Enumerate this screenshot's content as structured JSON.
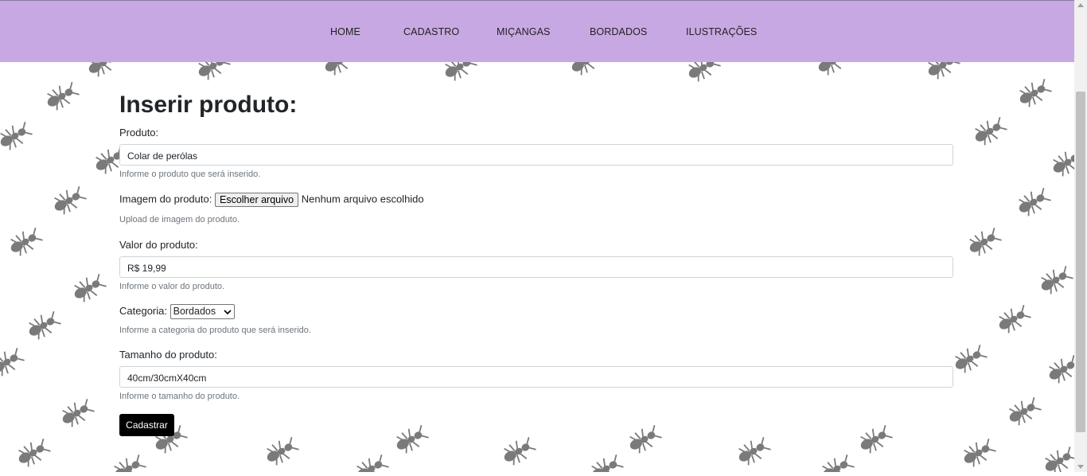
{
  "nav": {
    "items": [
      {
        "label": "HOME"
      },
      {
        "label": "CADASTRO"
      },
      {
        "label": "MIÇANGAS"
      },
      {
        "label": "BORDADOS"
      },
      {
        "label": "ILUSTRAÇÕES"
      }
    ]
  },
  "form": {
    "title": "Inserir produto:",
    "produto": {
      "label": "Produto:",
      "value": "Colar de perólas",
      "help": "Informe o produto que será inserido."
    },
    "imagem": {
      "label": "Imagem do produto:",
      "button_label": "Escolher arquivo",
      "status": "Nenhum arquivo escolhido",
      "help": "Upload de imagem do produto."
    },
    "valor": {
      "label": "Valor do produto:",
      "value": "R$ 19,99",
      "help": "Informe o valor do produto."
    },
    "categoria": {
      "label": "Categoria:",
      "selected": "Bordados",
      "help": "Informe a categoria do produto que será inserido."
    },
    "tamanho": {
      "label": "Tamanho do produto:",
      "value": "40cm/30cmX40cm",
      "help": "Informe o tamanho do produto."
    },
    "submit_label": "Cadastrar"
  },
  "colors": {
    "navbar": "#c8a8e2",
    "button": "#000000",
    "ant_pattern": "#7a7a7a"
  }
}
